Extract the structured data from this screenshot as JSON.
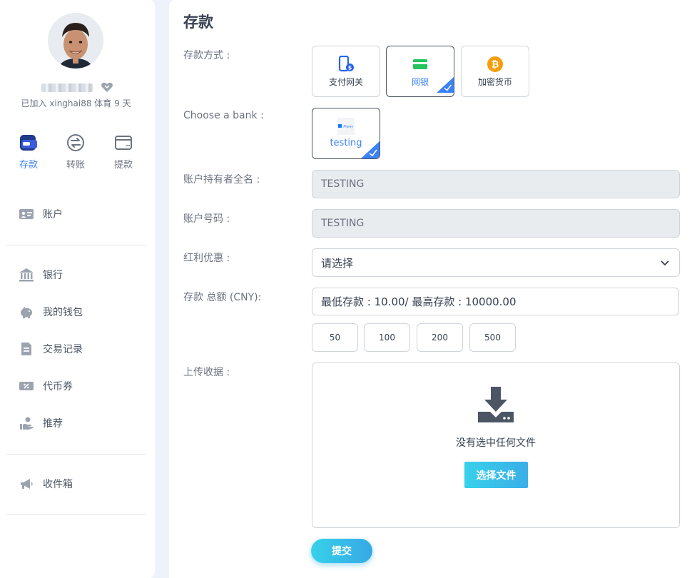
{
  "sidebar": {
    "joined_text": "已加入 xinghai88 体育 9 天",
    "quick_actions": [
      {
        "label": "存款",
        "icon": "wallet-icon",
        "active": true
      },
      {
        "label": "转账",
        "icon": "transfer-icon",
        "active": false
      },
      {
        "label": "提款",
        "icon": "card-icon",
        "active": false
      }
    ],
    "menu": {
      "account": "账户",
      "bank": "银行",
      "wallet": "我的钱包",
      "transactions": "交易记录",
      "vouchers": "代币券",
      "referral": "推荐",
      "inbox": "收件箱"
    }
  },
  "main": {
    "title": "存款",
    "deposit_method_label": "存款方式 :",
    "methods": [
      {
        "label": "支付网关",
        "icon": "mobile-pay-icon",
        "selected": false
      },
      {
        "label": "网银",
        "icon": "bank-card-icon",
        "selected": true
      },
      {
        "label": "加密货币",
        "icon": "bitcoin-icon",
        "selected": false
      }
    ],
    "choose_bank_label": "Choose a bank :",
    "bank": {
      "label": "testing",
      "logo_text": "Alipay"
    },
    "holder_label": "账户持有者全名 :",
    "holder_value": "TESTING",
    "account_no_label": "账户号码 :",
    "account_no_value": "TESTING",
    "bonus_label": "红利优惠 :",
    "bonus_selected": "请选择",
    "amount_label": "存款 总额 (CNY):",
    "amount_placeholder": "最低存款 : 10.00/ 最高存款 : 10000.00",
    "quick_amounts": [
      "50",
      "100",
      "200",
      "500"
    ],
    "upload_label": "上传收据 :",
    "no_file_text": "没有选中任何文件",
    "choose_file_label": "选择文件",
    "submit_label": "提交"
  },
  "colors": {
    "accent": "#3b82f6",
    "button_gradient_start": "#38d1ea",
    "button_gradient_end": "#3aaee8",
    "page_background": "#eef3fb"
  }
}
